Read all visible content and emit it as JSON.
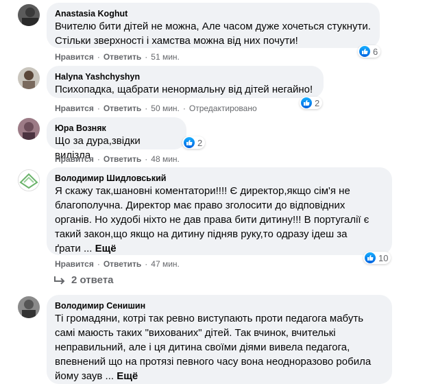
{
  "comments": [
    {
      "author": "Anastasia Koghut",
      "text": "Вчителю бити дітей не можна, Але часом дуже хочеться стукнути.\nСтільки зверхності і хамства можна від них почути!",
      "like_label": "Нравится",
      "reply_label": "Ответить",
      "time": "51 мин.",
      "reactions": "6"
    },
    {
      "author": "Halyna Yashchyshyn",
      "text": "Психопадка, щабрати ненормальну від дітей негайно!",
      "like_label": "Нравится",
      "reply_label": "Ответить",
      "time": "50 мин.",
      "edited": "Отредактировано",
      "reactions": "2"
    },
    {
      "author": "Юра Возняк",
      "text": "Що за дура,звідки вилізла",
      "like_label": "Нравится",
      "reply_label": "Ответить",
      "time": "48 мин.",
      "reactions": "2"
    },
    {
      "author": "Володимир Шидловський",
      "text": "Я скажу так,шановні коментатори!!!! Є директор,якщо сім'я не\nблагополучна. Директор має право зголосити до відповідних\nорганів. Но худобі ніхто не дав права бити дитину!!! В португалії є\nтакий закон,що якщо на дитину підняв руку,то одразу ідеш за\nґрати ...",
      "more": "Ещё",
      "like_label": "Нравится",
      "reply_label": "Ответить",
      "time": "47 мин.",
      "reactions": "10",
      "replies_label": "2 ответа"
    },
    {
      "author": "Володимир Сенишин",
      "text": "Ті громадяни, котрі так ревно виступають проти педагога мабуть\nсамі маюсть таких \"вихованих\" дітей. Так вчинок, вчителькі\nнеправильний, але і ця дитина своїми діями вивела педагога,\nвпевнений що на протязі певного часу вона неодноразово робила\nйому заув ...",
      "more": "Ещё"
    }
  ],
  "colors": {
    "bubble": "#f0f2f5",
    "meta": "#65676b",
    "like_blue": "#1877f2"
  },
  "icons": {
    "like": "thumbs-up-icon",
    "reply": "reply-arrow-icon"
  }
}
